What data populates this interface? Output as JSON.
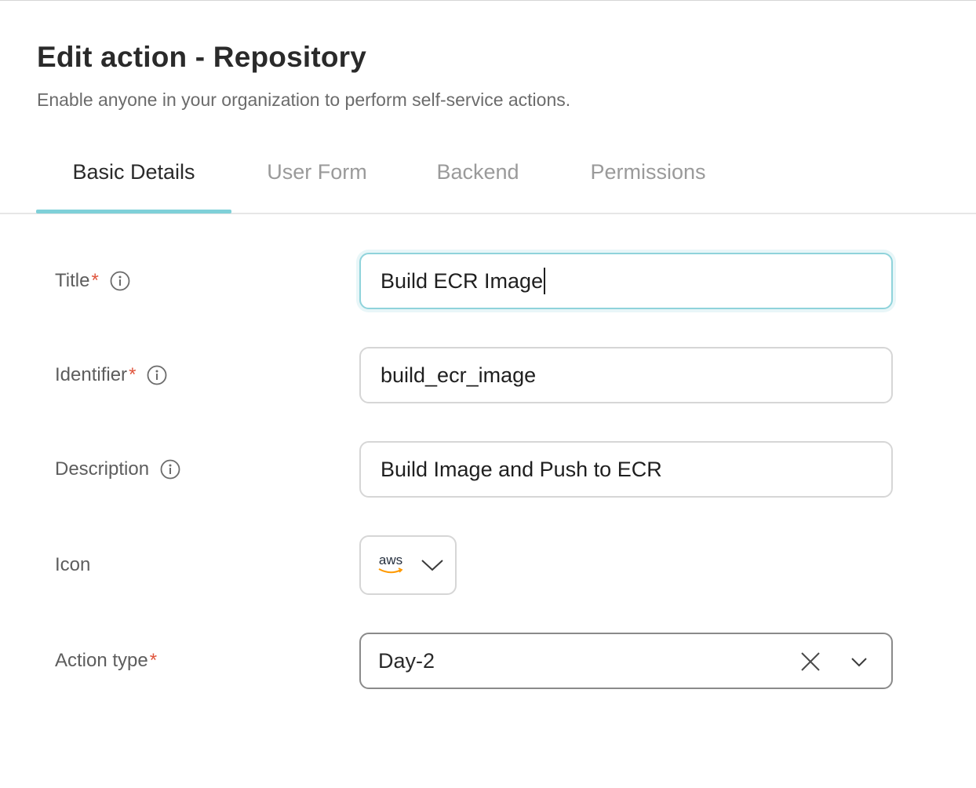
{
  "header": {
    "title": "Edit action - Repository",
    "subtitle": "Enable anyone in your organization to perform self-service actions."
  },
  "tabs": [
    {
      "label": "Basic Details",
      "active": true
    },
    {
      "label": "User Form",
      "active": false
    },
    {
      "label": "Backend",
      "active": false
    },
    {
      "label": "Permissions",
      "active": false
    }
  ],
  "form": {
    "title": {
      "label": "Title",
      "required_mark": "*",
      "value": "Build ECR Image",
      "icon": "info-icon"
    },
    "identifier": {
      "label": "Identifier",
      "required_mark": "*",
      "value": "build_ecr_image",
      "icon": "info-icon"
    },
    "description": {
      "label": "Description",
      "value": "Build Image and Push to ECR",
      "icon": "info-icon"
    },
    "icon": {
      "label": "Icon",
      "selected": "aws",
      "icon": "chevron-down-icon"
    },
    "action_type": {
      "label": "Action type",
      "required_mark": "*",
      "value": "Day-2",
      "clear_icon": "close-icon",
      "dropdown_icon": "chevron-down-icon"
    }
  },
  "colors": {
    "accent": "#7fd0d8",
    "required": "#e0553d",
    "aws_smile": "#ff9900"
  }
}
